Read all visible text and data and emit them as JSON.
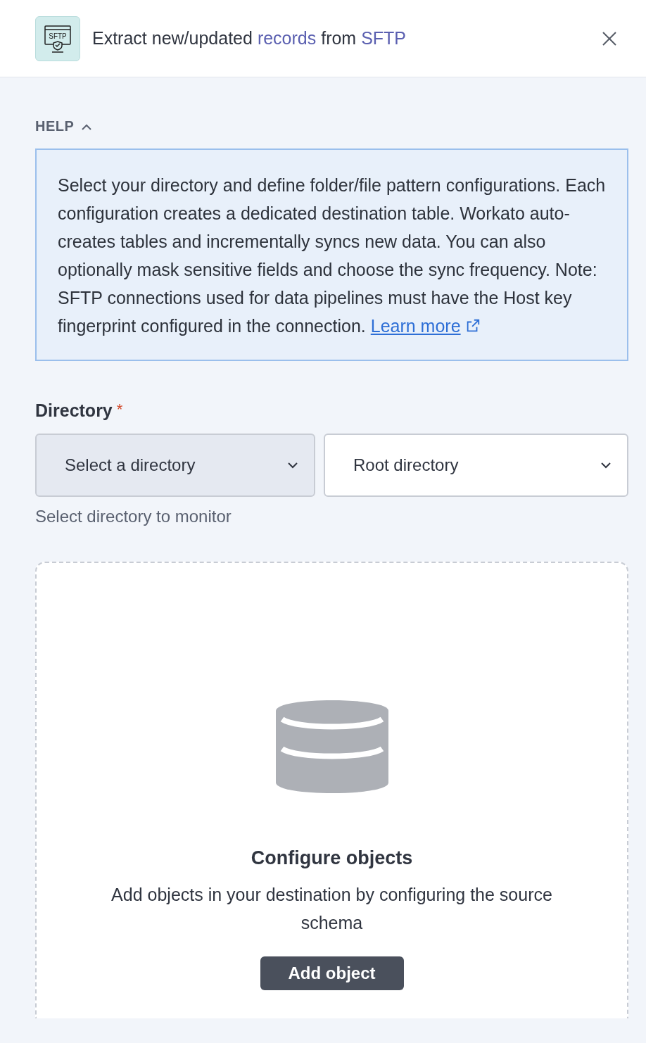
{
  "header": {
    "title": "Extract new/updated **records** from **SFTP**",
    "icon_label": "SFTP"
  },
  "help": {
    "label": "HELP",
    "expanded": true,
    "text": "Select your directory and define folder/file pattern configurations. Each configuration creates a dedicated destination table. Workato auto-creates tables and incrementally syncs new data. You can also optionally mask sensitive fields and choose the sync frequency. Note: SFTP connections used for data pipelines must have the Host key fingerprint configured in the connection.",
    "link": "Learn more"
  },
  "directory": {
    "label": "Directory",
    "required_mark": "*",
    "selects": [
      {
        "value": "Select a directory",
        "disabled": true
      },
      {
        "value": "Root directory",
        "disabled": false
      }
    ],
    "hint": "Select directory to monitor"
  },
  "empty_state": {
    "title": "Configure objects",
    "description": "Add objects in your destination by configuring the source schema",
    "button": "Add object"
  }
}
